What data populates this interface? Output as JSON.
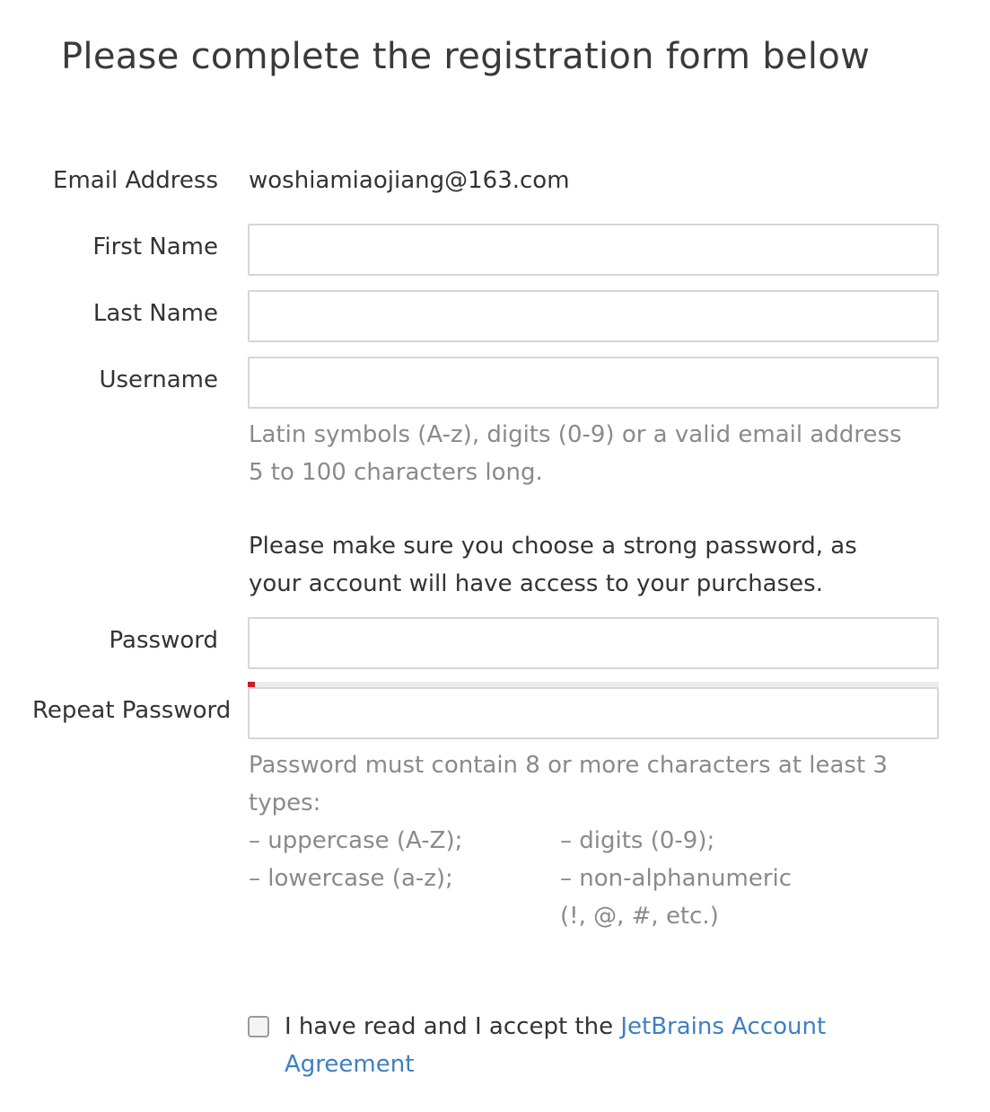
{
  "page": {
    "title": "Please complete the registration form below"
  },
  "email": {
    "label": "Email Address",
    "value": "woshiamiaojiang@163.com"
  },
  "first_name": {
    "label": "First Name",
    "value": ""
  },
  "last_name": {
    "label": "Last Name",
    "value": ""
  },
  "username": {
    "label": "Username",
    "value": "",
    "hint": "Latin symbols (A-z), digits (0-9) or a valid email address 5 to 100 characters long."
  },
  "password_notice": "Please make sure you choose a strong password, as your account will have access to your purchases.",
  "password": {
    "label": "Password",
    "value": "",
    "strength_percent": 1
  },
  "repeat_password": {
    "label": "Repeat Password",
    "value": ""
  },
  "password_rules": {
    "intro": "Password must contain 8 or more characters at least 3 types:",
    "col1": [
      "– uppercase (A-Z);",
      "– lowercase (a-z);"
    ],
    "col2": [
      "– digits (0-9);",
      "– non-alphanumeric",
      "(!, @, #, etc.)"
    ]
  },
  "agreement": {
    "checked": false,
    "text": "I have read and I accept the ",
    "link_text": "JetBrains Account Agreement"
  },
  "colors": {
    "strength_indicator": "#c8202a",
    "link": "#3f7fc2",
    "hint_text": "#8a8a8a",
    "input_border": "#d6d6d6"
  }
}
